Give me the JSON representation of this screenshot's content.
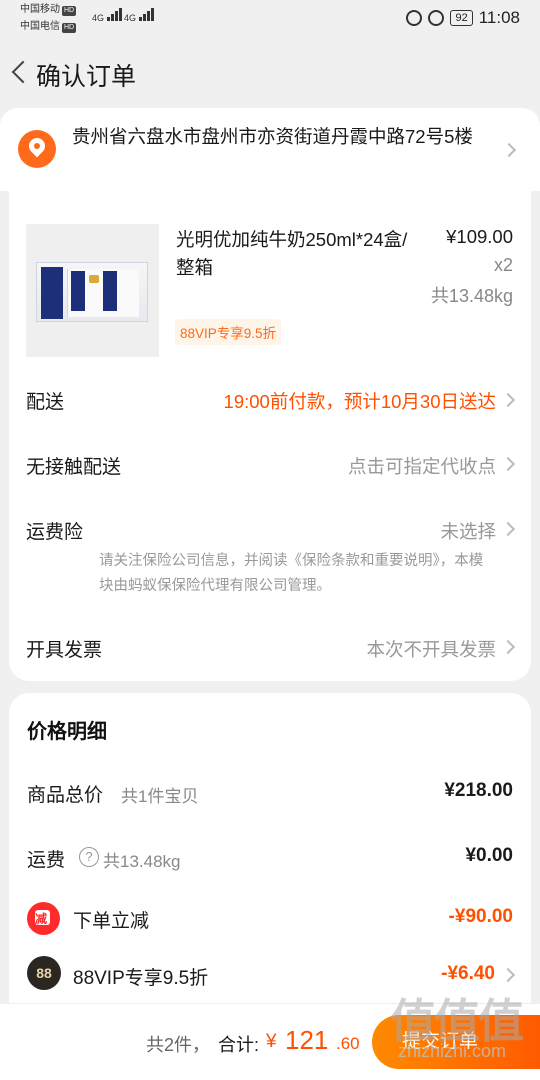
{
  "status_bar": {
    "carrier1": "中国移动",
    "carrier2": "中国电信",
    "hd": "HD",
    "signal1": "4G",
    "signal2": "4G",
    "battery": "92",
    "time": "11:08"
  },
  "nav": {
    "title": "确认订单"
  },
  "address": {
    "text": "贵州省六盘水市盘州市亦资街道丹霞中路72号5楼"
  },
  "order": {
    "product": {
      "name": "光明优加纯牛奶250ml*24盒/整箱",
      "price": "¥109.00",
      "qty": "x2",
      "weight": "共13.48kg",
      "vip_badge": "88VIP专享9.5折"
    },
    "rows": {
      "delivery_label": "配送",
      "delivery_value": "19:00前付款，预计10月30日送达",
      "contactless_label": "无接触配送",
      "contactless_value": "点击可指定代收点",
      "insurance_label": "运费险",
      "insurance_value": "未选择",
      "insurance_note": "请关注保险公司信息，并阅读《保险条款和重要说明》，本模块由蚂蚁保保险代理有限公司管理。",
      "invoice_label": "开具发票",
      "invoice_value": "本次不开具发票"
    }
  },
  "price_detail": {
    "title": "价格明细",
    "goods_label": "商品总价",
    "goods_sub": "共1件宝贝",
    "goods_value": "¥218.00",
    "shipping_label": "运费",
    "shipping_help": "?",
    "shipping_sub": "共13.48kg",
    "shipping_value": "¥0.00",
    "discount_icon_text": "减",
    "discount_label": "下单立减",
    "discount_value": "-¥90.00",
    "vip_icon_text": "88",
    "vip_label": "88VIP专享9.5折",
    "vip_value": "-¥6.40"
  },
  "bottom_bar": {
    "count": "共2件，",
    "total_label": "合计:",
    "currency": "¥",
    "total_int": "121",
    "total_dec": ".60",
    "submit": "提交订单"
  },
  "watermark": {
    "glyphs": "值值值",
    "url": "zhizhizhi.com"
  },
  "colors": {
    "accent": "#ff5000",
    "submit_gradient_start": "#ff8a00",
    "submit_gradient_end": "#ff5a00",
    "pin": "#ff6a1a"
  }
}
